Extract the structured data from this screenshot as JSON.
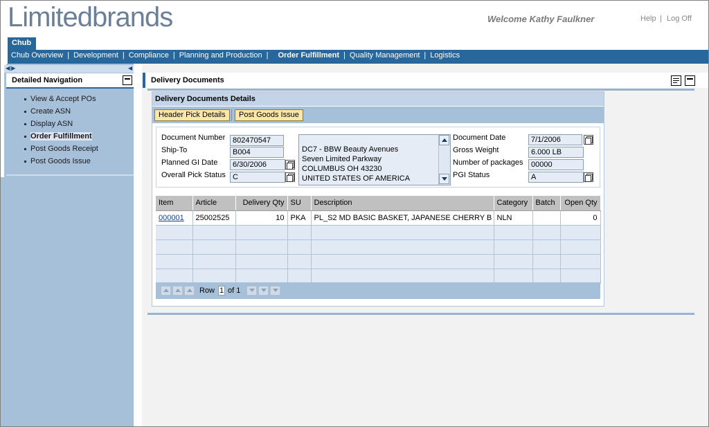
{
  "header": {
    "logo": "Limitedbrands",
    "welcome": "Welcome Kathy Faulkner",
    "help": "Help",
    "separator": "|",
    "logoff": "Log Off"
  },
  "top_tab": "Chub",
  "nav": {
    "items": [
      {
        "label": "Chub Overview",
        "active": false
      },
      {
        "label": "Development",
        "active": false
      },
      {
        "label": "Compliance",
        "active": false
      },
      {
        "label": "Planning and Production",
        "active": false
      },
      {
        "label": "Order Fulfillment",
        "active": true
      },
      {
        "label": "Quality Management",
        "active": false
      },
      {
        "label": "Logistics",
        "active": false
      }
    ]
  },
  "left_nav": {
    "title": "Detailed Navigation",
    "items": [
      "View & Accept POs",
      "Create ASN",
      "Display ASN",
      "Order Fulfillment",
      "Post Goods Receipt",
      "Post Goods Issue"
    ],
    "active_index": 3
  },
  "main": {
    "title": "Delivery Documents",
    "tray_title": "Delivery Documents Details",
    "buttons": {
      "header_pick": "Header Pick Details",
      "post_goods_issue": "Post Goods Issue"
    }
  },
  "form": {
    "document_number": {
      "label": "Document Number",
      "value": "802470547"
    },
    "ship_to": {
      "label": "Ship-To",
      "value": "B004"
    },
    "planned_gi_date": {
      "label": "Planned GI Date",
      "value": "6/30/2006"
    },
    "overall_pick_status": {
      "label": "Overall Pick Status",
      "value": "C"
    },
    "address_lines": [
      "DC7 - BBW Beauty Avenues",
      "Seven Limited Parkway",
      "COLUMBUS OH  43230",
      "UNITED STATES OF AMERICA"
    ],
    "document_date": {
      "label": "Document Date",
      "value": "7/1/2006"
    },
    "gross_weight": {
      "label": "Gross Weight",
      "value": "6.000 LB"
    },
    "number_of_packages": {
      "label": "Number of packages",
      "value": "00000"
    },
    "pgi_status": {
      "label": "PGI Status",
      "value": "A"
    }
  },
  "table": {
    "columns": [
      "Item",
      "Article",
      "Delivery Qty",
      "SU",
      "Description",
      "Category",
      "Batch",
      "Open Qty"
    ],
    "rows": [
      {
        "item": "000001",
        "article": "25002525",
        "delivery_qty": "10",
        "su": "PKA",
        "description": "PL_S2 MD BASIC BASKET, JAPANESE CHERRY B",
        "category": "NLN",
        "batch": "",
        "open_qty": "0"
      }
    ],
    "footer": {
      "row_label": "Row",
      "row_value": "1",
      "of_label": "of 1"
    }
  },
  "colors": {
    "brand_blue": "#28679c",
    "panel_blue": "#a7c0d9",
    "button_yellow": "#fde6a8",
    "logo_gray": "#6b7f99"
  }
}
